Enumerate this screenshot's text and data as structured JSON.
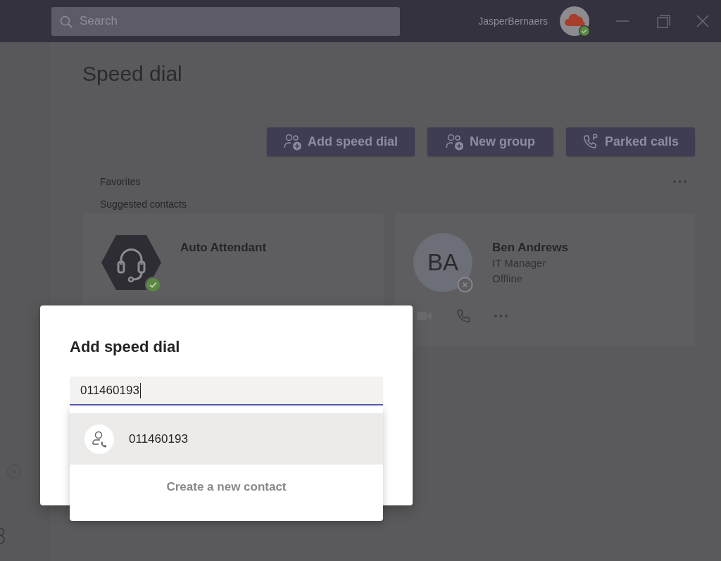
{
  "title_bar": {
    "search": {
      "placeholder": "Search"
    },
    "user": {
      "name": "JasperBernaers",
      "available": true
    }
  },
  "page": {
    "title": "Speed dial",
    "actions": [
      {
        "label": "Add speed dial",
        "kind": "add-people"
      },
      {
        "label": "New group",
        "kind": "add-people"
      },
      {
        "label": "Parked calls",
        "kind": "parked-call"
      }
    ],
    "sections": [
      "Favorites",
      "Suggested contacts"
    ],
    "contacts": [
      {
        "kind": "bot",
        "name": "Auto Attendant",
        "available": true
      },
      {
        "kind": "person",
        "initials": "BA",
        "name": "Ben Andrews",
        "title": "IT Manager",
        "presence": "Offline",
        "available": false
      }
    ]
  },
  "dialog": {
    "title": "Add speed dial",
    "input": {
      "value": "011460193"
    },
    "suggestions": [
      {
        "label": "011460193",
        "selected": true
      }
    ],
    "create_contact": "Create a new contact"
  }
}
